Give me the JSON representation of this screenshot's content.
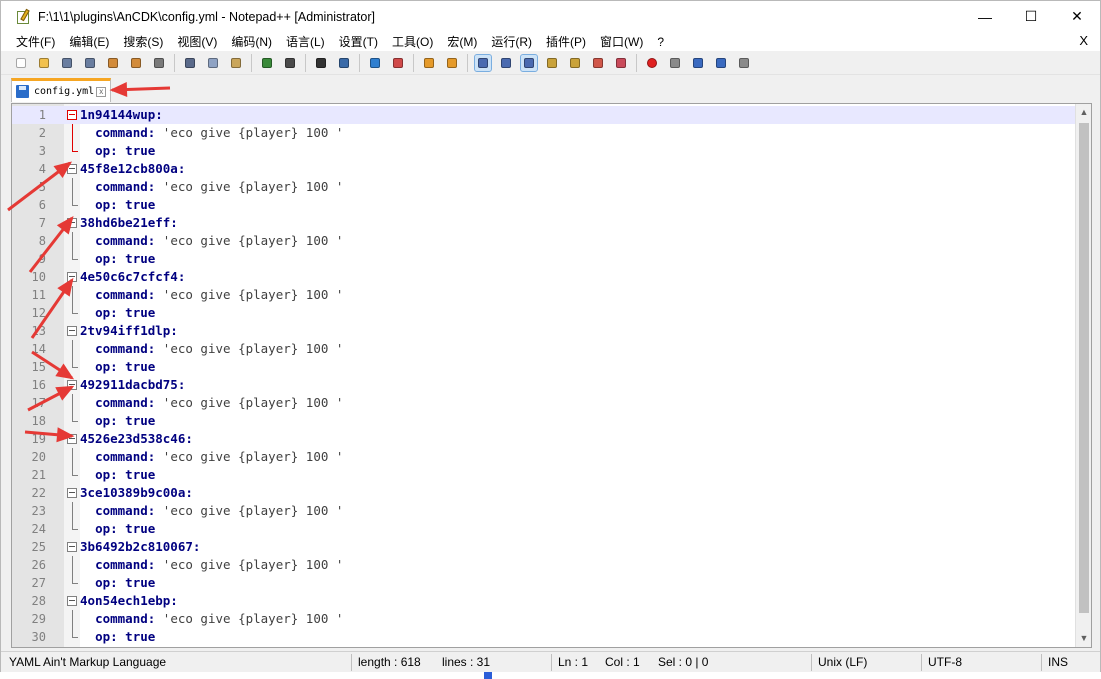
{
  "window": {
    "title": "F:\\1\\1\\plugins\\AnCDK\\config.yml - Notepad++ [Administrator]",
    "controls": {
      "minimize": "—",
      "maximize": "☐",
      "close": "✕"
    }
  },
  "menu": {
    "items": [
      "文件(F)",
      "编辑(E)",
      "搜索(S)",
      "视图(V)",
      "编码(N)",
      "语言(L)",
      "设置(T)",
      "工具(O)",
      "宏(M)",
      "运行(R)",
      "插件(P)",
      "窗口(W)",
      "?"
    ],
    "close_label": "X"
  },
  "toolbar": {
    "icons": [
      "new-file-icon",
      "open-file-icon",
      "save-icon",
      "save-all-icon",
      "close-icon",
      "close-all-icon",
      "print-icon",
      "sep",
      "cut-icon",
      "copy-icon",
      "paste-icon",
      "sep",
      "undo-icon",
      "redo-icon",
      "sep",
      "find-icon",
      "replace-icon",
      "sep",
      "zoom-in-icon",
      "zoom-out-icon",
      "sep",
      "sync-vertical-icon",
      "sync-horizontal-icon",
      "sep",
      "word-wrap-icon",
      "show-all-chars-icon",
      "indent-guide-icon",
      "doc-map-icon",
      "function-list-icon",
      "folder-workspace-icon",
      "monitoring-icon",
      "sep",
      "record-macro-icon",
      "stop-macro-icon",
      "play-macro-icon",
      "run-macro-multiple-icon",
      "save-macro-icon"
    ]
  },
  "tab": {
    "label": "config.yml",
    "close": "x"
  },
  "editor": {
    "lines": [
      {
        "n": "1",
        "kind": "key",
        "text": "1n94144wup:"
      },
      {
        "n": "2",
        "kind": "cmd",
        "key": "command:",
        "val": " 'eco give {player} 100 '"
      },
      {
        "n": "3",
        "kind": "op",
        "key": "op:",
        "val": "true"
      },
      {
        "n": "4",
        "kind": "key",
        "text": "45f8e12cb800a:"
      },
      {
        "n": "5",
        "kind": "cmd",
        "key": "command:",
        "val": " 'eco give {player} 100 '"
      },
      {
        "n": "6",
        "kind": "op",
        "key": "op:",
        "val": "true"
      },
      {
        "n": "7",
        "kind": "key",
        "text": "38hd6be21eff:"
      },
      {
        "n": "8",
        "kind": "cmd",
        "key": "command:",
        "val": " 'eco give {player} 100 '"
      },
      {
        "n": "9",
        "kind": "op",
        "key": "op:",
        "val": "true"
      },
      {
        "n": "10",
        "kind": "key",
        "text": "4e50c6c7cfcf4:"
      },
      {
        "n": "11",
        "kind": "cmd",
        "key": "command:",
        "val": " 'eco give {player} 100 '"
      },
      {
        "n": "12",
        "kind": "op",
        "key": "op:",
        "val": "true"
      },
      {
        "n": "13",
        "kind": "key",
        "text": "2tv94iff1dlp:"
      },
      {
        "n": "14",
        "kind": "cmd",
        "key": "command:",
        "val": " 'eco give {player} 100 '"
      },
      {
        "n": "15",
        "kind": "op",
        "key": "op:",
        "val": "true"
      },
      {
        "n": "16",
        "kind": "key",
        "text": "492911dacbd75:"
      },
      {
        "n": "17",
        "kind": "cmd",
        "key": "command:",
        "val": " 'eco give {player} 100 '"
      },
      {
        "n": "18",
        "kind": "op",
        "key": "op:",
        "val": "true"
      },
      {
        "n": "19",
        "kind": "key",
        "text": "4526e23d538c46:"
      },
      {
        "n": "20",
        "kind": "cmd",
        "key": "command:",
        "val": " 'eco give {player} 100 '"
      },
      {
        "n": "21",
        "kind": "op",
        "key": "op:",
        "val": "true"
      },
      {
        "n": "22",
        "kind": "key",
        "text": "3ce10389b9c00a:"
      },
      {
        "n": "23",
        "kind": "cmd",
        "key": "command:",
        "val": " 'eco give {player} 100 '"
      },
      {
        "n": "24",
        "kind": "op",
        "key": "op:",
        "val": "true"
      },
      {
        "n": "25",
        "kind": "key",
        "text": "3b6492b2c810067:"
      },
      {
        "n": "26",
        "kind": "cmd",
        "key": "command:",
        "val": " 'eco give {player} 100 '"
      },
      {
        "n": "27",
        "kind": "op",
        "key": "op:",
        "val": "true"
      },
      {
        "n": "28",
        "kind": "key",
        "text": "4on54ech1ebp:"
      },
      {
        "n": "29",
        "kind": "cmd",
        "key": "command:",
        "val": " 'eco give {player} 100 '"
      },
      {
        "n": "30",
        "kind": "op",
        "key": "op:",
        "val": "true"
      }
    ]
  },
  "status": {
    "language": "YAML Ain't Markup Language",
    "length": "length : 618",
    "lines": "lines : 31",
    "ln": "Ln : 1",
    "col": "Col : 1",
    "sel": "Sel : 0 | 0",
    "eol": "Unix (LF)",
    "encoding": "UTF-8",
    "mode": "INS"
  },
  "colors": {
    "annotation_arrow": "#e53935",
    "key_text": "#000080",
    "current_line": "#e8e8ff",
    "tab_accent": "#f6a623"
  }
}
